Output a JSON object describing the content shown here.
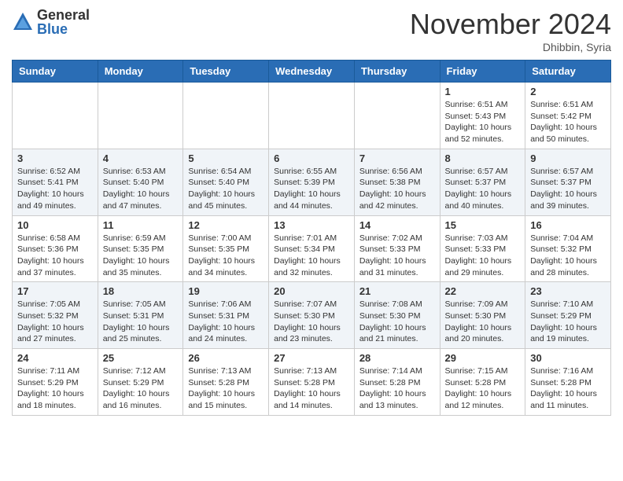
{
  "logo": {
    "general": "General",
    "blue": "Blue"
  },
  "title": "November 2024",
  "location": "Dhibbin, Syria",
  "days_of_week": [
    "Sunday",
    "Monday",
    "Tuesday",
    "Wednesday",
    "Thursday",
    "Friday",
    "Saturday"
  ],
  "weeks": [
    [
      {
        "day": "",
        "info": ""
      },
      {
        "day": "",
        "info": ""
      },
      {
        "day": "",
        "info": ""
      },
      {
        "day": "",
        "info": ""
      },
      {
        "day": "",
        "info": ""
      },
      {
        "day": "1",
        "info": "Sunrise: 6:51 AM\nSunset: 5:43 PM\nDaylight: 10 hours\nand 52 minutes."
      },
      {
        "day": "2",
        "info": "Sunrise: 6:51 AM\nSunset: 5:42 PM\nDaylight: 10 hours\nand 50 minutes."
      }
    ],
    [
      {
        "day": "3",
        "info": "Sunrise: 6:52 AM\nSunset: 5:41 PM\nDaylight: 10 hours\nand 49 minutes."
      },
      {
        "day": "4",
        "info": "Sunrise: 6:53 AM\nSunset: 5:40 PM\nDaylight: 10 hours\nand 47 minutes."
      },
      {
        "day": "5",
        "info": "Sunrise: 6:54 AM\nSunset: 5:40 PM\nDaylight: 10 hours\nand 45 minutes."
      },
      {
        "day": "6",
        "info": "Sunrise: 6:55 AM\nSunset: 5:39 PM\nDaylight: 10 hours\nand 44 minutes."
      },
      {
        "day": "7",
        "info": "Sunrise: 6:56 AM\nSunset: 5:38 PM\nDaylight: 10 hours\nand 42 minutes."
      },
      {
        "day": "8",
        "info": "Sunrise: 6:57 AM\nSunset: 5:37 PM\nDaylight: 10 hours\nand 40 minutes."
      },
      {
        "day": "9",
        "info": "Sunrise: 6:57 AM\nSunset: 5:37 PM\nDaylight: 10 hours\nand 39 minutes."
      }
    ],
    [
      {
        "day": "10",
        "info": "Sunrise: 6:58 AM\nSunset: 5:36 PM\nDaylight: 10 hours\nand 37 minutes."
      },
      {
        "day": "11",
        "info": "Sunrise: 6:59 AM\nSunset: 5:35 PM\nDaylight: 10 hours\nand 35 minutes."
      },
      {
        "day": "12",
        "info": "Sunrise: 7:00 AM\nSunset: 5:35 PM\nDaylight: 10 hours\nand 34 minutes."
      },
      {
        "day": "13",
        "info": "Sunrise: 7:01 AM\nSunset: 5:34 PM\nDaylight: 10 hours\nand 32 minutes."
      },
      {
        "day": "14",
        "info": "Sunrise: 7:02 AM\nSunset: 5:33 PM\nDaylight: 10 hours\nand 31 minutes."
      },
      {
        "day": "15",
        "info": "Sunrise: 7:03 AM\nSunset: 5:33 PM\nDaylight: 10 hours\nand 29 minutes."
      },
      {
        "day": "16",
        "info": "Sunrise: 7:04 AM\nSunset: 5:32 PM\nDaylight: 10 hours\nand 28 minutes."
      }
    ],
    [
      {
        "day": "17",
        "info": "Sunrise: 7:05 AM\nSunset: 5:32 PM\nDaylight: 10 hours\nand 27 minutes."
      },
      {
        "day": "18",
        "info": "Sunrise: 7:05 AM\nSunset: 5:31 PM\nDaylight: 10 hours\nand 25 minutes."
      },
      {
        "day": "19",
        "info": "Sunrise: 7:06 AM\nSunset: 5:31 PM\nDaylight: 10 hours\nand 24 minutes."
      },
      {
        "day": "20",
        "info": "Sunrise: 7:07 AM\nSunset: 5:30 PM\nDaylight: 10 hours\nand 23 minutes."
      },
      {
        "day": "21",
        "info": "Sunrise: 7:08 AM\nSunset: 5:30 PM\nDaylight: 10 hours\nand 21 minutes."
      },
      {
        "day": "22",
        "info": "Sunrise: 7:09 AM\nSunset: 5:30 PM\nDaylight: 10 hours\nand 20 minutes."
      },
      {
        "day": "23",
        "info": "Sunrise: 7:10 AM\nSunset: 5:29 PM\nDaylight: 10 hours\nand 19 minutes."
      }
    ],
    [
      {
        "day": "24",
        "info": "Sunrise: 7:11 AM\nSunset: 5:29 PM\nDaylight: 10 hours\nand 18 minutes."
      },
      {
        "day": "25",
        "info": "Sunrise: 7:12 AM\nSunset: 5:29 PM\nDaylight: 10 hours\nand 16 minutes."
      },
      {
        "day": "26",
        "info": "Sunrise: 7:13 AM\nSunset: 5:28 PM\nDaylight: 10 hours\nand 15 minutes."
      },
      {
        "day": "27",
        "info": "Sunrise: 7:13 AM\nSunset: 5:28 PM\nDaylight: 10 hours\nand 14 minutes."
      },
      {
        "day": "28",
        "info": "Sunrise: 7:14 AM\nSunset: 5:28 PM\nDaylight: 10 hours\nand 13 minutes."
      },
      {
        "day": "29",
        "info": "Sunrise: 7:15 AM\nSunset: 5:28 PM\nDaylight: 10 hours\nand 12 minutes."
      },
      {
        "day": "30",
        "info": "Sunrise: 7:16 AM\nSunset: 5:28 PM\nDaylight: 10 hours\nand 11 minutes."
      }
    ]
  ]
}
